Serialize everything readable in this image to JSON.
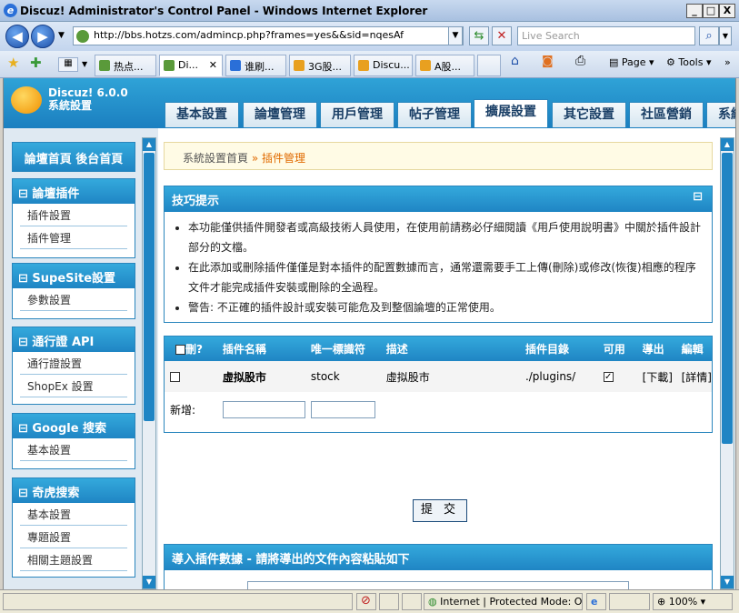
{
  "window": {
    "title": "Discuz! Administrator's Control Panel - Windows Internet Explorer",
    "min": "_",
    "max": "□",
    "close": "X"
  },
  "address": {
    "url": "http://bbs.hotzs.com/admincp.php?frames=yes&&sid=nqesAf",
    "search_placeholder": "Live Search"
  },
  "tabs": [
    {
      "label": "热点...",
      "color": "#5a9a3a"
    },
    {
      "label": "Di...",
      "color": "#5a9a3a",
      "close": "✕"
    },
    {
      "label": "谁刷...",
      "color": "#2a6fd8"
    },
    {
      "label": "3G股...",
      "color": "#e8a020"
    },
    {
      "label": "Discu...",
      "color": "#e8a020"
    },
    {
      "label": "A股...",
      "color": "#e8a020"
    }
  ],
  "toolbar": {
    "page": "Page",
    "tools": "Tools"
  },
  "app": {
    "brand_line1": "Discuz! 6.0.0",
    "brand_line2": "系統設置",
    "main_tabs": [
      "基本設置",
      "論壇管理",
      "用戶管理",
      "帖子管理",
      "擴展設置",
      "其它設置",
      "社區營銷",
      "系統"
    ],
    "active_tab_index": 4
  },
  "sidebar": {
    "top_links": "論壇首頁  後台首頁",
    "groups": [
      {
        "title": "⊟ 論壇插件",
        "items": [
          "插件設置",
          "插件管理"
        ]
      },
      {
        "title": "⊟ SupeSite設置",
        "items": [
          "參數設置"
        ]
      },
      {
        "title": "⊟ 通行證  API",
        "items": [
          "通行證設置",
          "ShopEx 設置"
        ]
      },
      {
        "title": "⊟ Google 搜索",
        "items": [
          "基本設置"
        ]
      },
      {
        "title": "⊟ 奇虎搜索",
        "items": [
          "基本設置",
          "專題設置",
          "相關主題設置"
        ]
      }
    ]
  },
  "breadcrumb": {
    "home": "系統設置首頁",
    "sep": " » ",
    "current": "插件管理"
  },
  "tips": {
    "title": "技巧提示",
    "collapse": "⊟",
    "items": [
      "本功能僅供插件開發者或高級技術人員使用，在使用前請務必仔細閱讀《用戶使用說明書》中關於插件設計部分的文檔。",
      "在此添加或刪除插件僅僅是對本插件的配置數據而言，通常還需要手工上傳(刪除)或修改(恢復)相應的程序文件才能完成插件安裝或刪除的全過程。",
      "警告: 不正確的插件設計或安裝可能危及到整個論壇的正常使用。"
    ]
  },
  "plugins_table": {
    "headers": [
      "刪?",
      "插件名稱",
      "唯一標識符",
      "描述",
      "插件目錄",
      "可用",
      "導出",
      "編輯"
    ],
    "rows": [
      {
        "name": "虛拟股市",
        "identifier": "stock",
        "description": "虛拟股市",
        "directory": "./plugins/",
        "enabled": "✓",
        "export": "[下載]",
        "edit": "[詳情]"
      }
    ],
    "new_label": "新增:"
  },
  "submit_label": "提 交",
  "import_panel": {
    "title": "導入插件數據  - 請將導出的文件內容粘貼如下"
  },
  "status": {
    "zone": "Internet | Protected Mode: Off",
    "zoom": "100%"
  }
}
